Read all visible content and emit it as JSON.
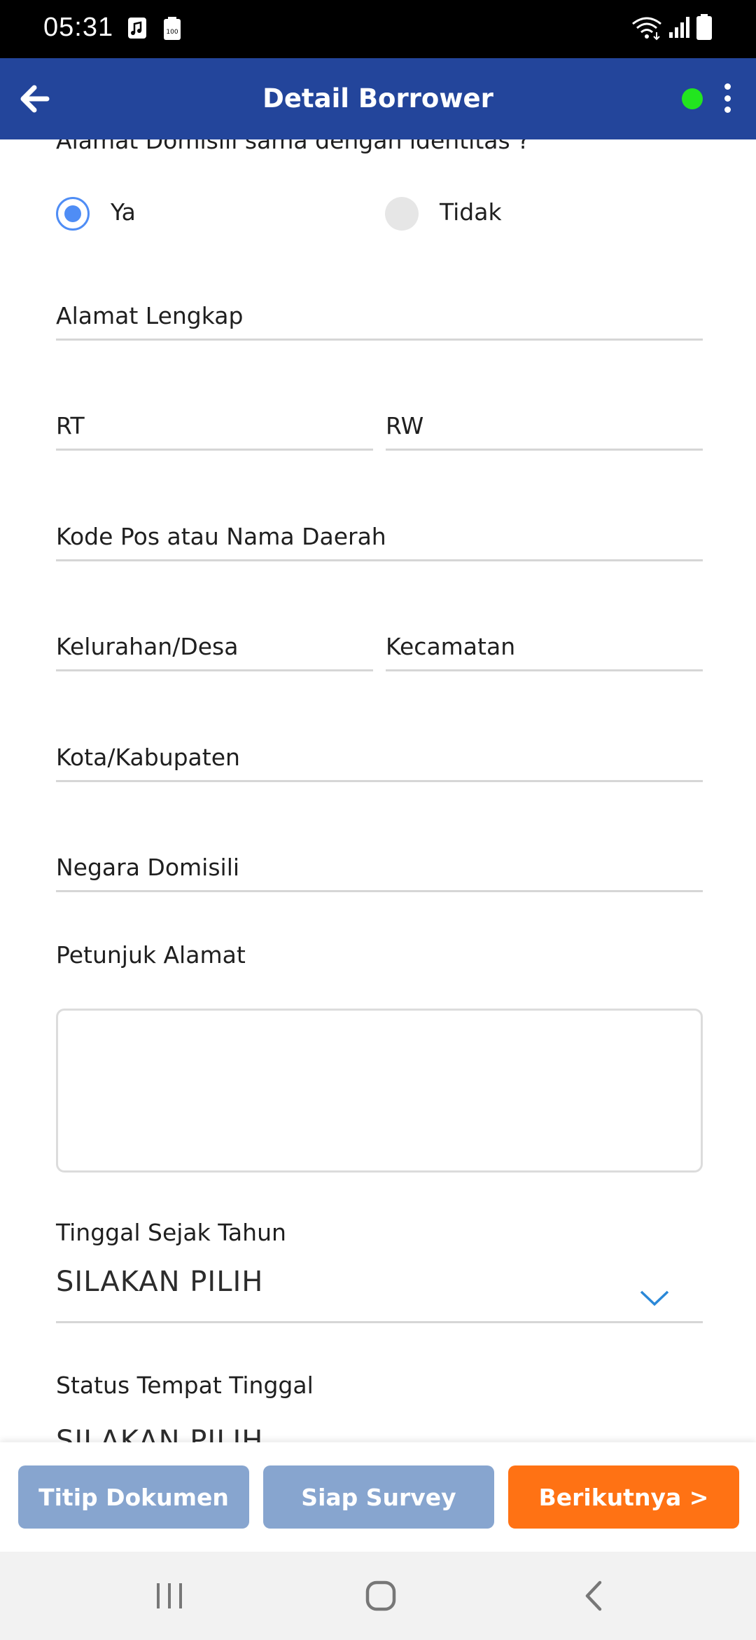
{
  "status_bar": {
    "time": "05:31",
    "left_icons": [
      "music-note-icon",
      "battery-100-icon"
    ],
    "right_icons": [
      "wifi-icon",
      "signal-icon",
      "battery-icon"
    ]
  },
  "app_bar": {
    "title": "Detail Borrower",
    "back_icon": "back-arrow-icon",
    "status_dot_color": "#22e51f",
    "menu_icon": "more-vert-icon",
    "color": "#23459b"
  },
  "form": {
    "same_address_question": "Alamat Domisili sama dengan identitas ?",
    "radio_options": [
      {
        "label": "Ya",
        "selected": true
      },
      {
        "label": "Tidak",
        "selected": false
      }
    ],
    "fields": {
      "alamat_lengkap": "Alamat Lengkap",
      "rt": "RT",
      "rw": "RW",
      "kode_pos": "Kode Pos atau Nama Daerah",
      "kelurahan": "Kelurahan/Desa",
      "kecamatan": "Kecamatan",
      "kota": "Kota/Kabupaten",
      "negara": "Negara Domisili"
    },
    "petunjuk_label": "Petunjuk Alamat",
    "petunjuk_value": "",
    "tinggal_sejak_label": "Tinggal Sejak Tahun",
    "tinggal_sejak_value": "SILAKAN PILIH",
    "status_tempat_label": "Status Tempat Tinggal",
    "status_tempat_value": "SILAKAN PILIH"
  },
  "actions": {
    "titip_dokumen": "Titip Dokumen",
    "siap_survey": "Siap Survey",
    "berikutnya": "Berikutnya >"
  },
  "nav_bar": {
    "icons": [
      "recent-apps-icon",
      "home-icon",
      "back-icon"
    ]
  }
}
